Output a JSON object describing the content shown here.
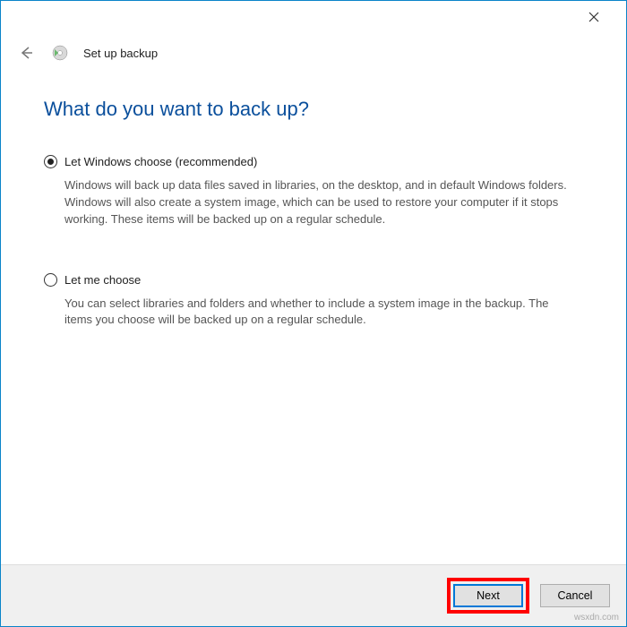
{
  "header": {
    "page_title": "Set up backup"
  },
  "main": {
    "heading": "What do you want to back up?",
    "options": [
      {
        "label": "Let Windows choose (recommended)",
        "description": "Windows will back up data files saved in libraries, on the desktop, and in default Windows folders. Windows will also create a system image, which can be used to restore your computer if it stops working. These items will be backed up on a regular schedule.",
        "selected": true
      },
      {
        "label": "Let me choose",
        "description": "You can select libraries and folders and whether to include a system image in the backup. The items you choose will be backed up on a regular schedule.",
        "selected": false
      }
    ]
  },
  "footer": {
    "next_label": "Next",
    "cancel_label": "Cancel"
  },
  "watermark": "wsxdn.com"
}
